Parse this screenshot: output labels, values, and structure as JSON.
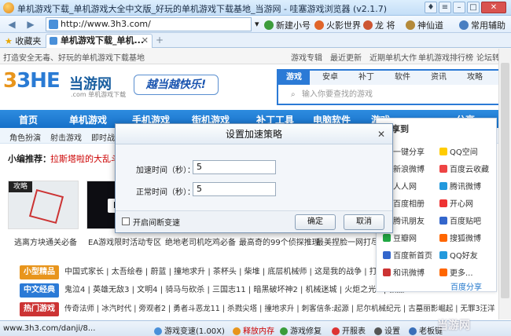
{
  "window": {
    "title": "单机游戏下载_单机游戏大全中文版_好玩的单机游戏下载基地_当游网 - 哇塞游戏浏览器 (v2.1.7)"
  },
  "toolbar": {
    "back": "◀",
    "forward": "▶",
    "url": "http://www.3h3.com/",
    "dropdown": "▾",
    "links": [
      "新建小号",
      "火影世界",
      "龙  将",
      "神仙道",
      "常用辅助"
    ]
  },
  "tabs": {
    "favorites": "收藏夹",
    "active_tab": "单机游戏下载_单机...",
    "close": "✕",
    "new_tab": "+"
  },
  "site": {
    "top_left": "打造安全无毒、好玩的单机游戏下载基地",
    "top_links": [
      "游戏专辑",
      "最近更新",
      "近期单机大作",
      "单机游戏排行榜",
      "论坛转"
    ],
    "logo": "3HE",
    "logo_cn": "当游网",
    "logo_sub": ".com 单机游戏下载",
    "slogan": "越当越快乐!",
    "search_tabs": [
      "游戏",
      "安卓",
      "补丁",
      "软件",
      "资讯",
      "攻略"
    ],
    "search_placeholder": "输入你要查找的游戏",
    "main_nav": [
      "首页",
      "单机游戏",
      "手机游戏",
      "街机游戏",
      "补丁工具",
      "电脑软件",
      "游戏",
      "分享"
    ],
    "sub_nav": [
      "角色扮演",
      "射击游戏",
      "即时战略"
    ],
    "recommend_label": "小编推荐：",
    "recommend_text": "拉斯塔啦的大乱斗新作",
    "thumb_badge": "攻略",
    "captions": [
      "逃离方块通关必备",
      "EA游戏限时活动专区",
      "绝地老司机吃鸡必备",
      "最高奇的99个侦探推理",
      "最美捏脸一网打尽"
    ],
    "sections": [
      {
        "label": "小型精品",
        "items": "中国式家长 | 太吾绘卷 | 蔚蓝 | 撞地求升 | 茶杯头 | 柴堆 | 底层机械师 | 这是我的战争 | 打造世"
      },
      {
        "label": "中文经典",
        "items": "鬼泣4 | 英雄无敌3 | 文明4 | 骑马与砍杀 | 三国志11 | 暗黑破坏神2 | 机械迷城 | 火炬之光2 | 极品"
      },
      {
        "label": "热门游戏",
        "items": "传奇法师 | 冰汽时代 | 旁观者2 | 勇者斗恶龙11 | 杀戮尖塔 | 撞地求升 | 刺客信条:起源 | 尼尔机械纪元 | 古墓丽影崛起 | 无罪3汪洋"
      }
    ]
  },
  "share_panel": {
    "title": "分享到",
    "items": [
      [
        "一键分享",
        "QQ空间"
      ],
      [
        "新浪微博",
        "百度云收藏"
      ],
      [
        "人人网",
        "腾讯微博"
      ],
      [
        "百度相册",
        "开心网"
      ],
      [
        "腾讯朋友",
        "百度贴吧"
      ],
      [
        "豆瓣网",
        "搜狐微博"
      ],
      [
        "百度新首页",
        "QQ好友"
      ],
      [
        "和讯微博",
        "更多..."
      ]
    ],
    "footer": "百度分享"
  },
  "dialog": {
    "title": "设置加速策略",
    "close": "✕",
    "accel_label": "加速时间（秒）：",
    "accel_value": "5",
    "normal_label": "正常时间（秒）：",
    "normal_value": "5",
    "checkbox_label": "开启间断变速",
    "ok": "确定",
    "cancel": "取消"
  },
  "status": {
    "url": "www.3h3.com/danji/8...",
    "speed": "游戏变速(1.00X)",
    "memory": "释放内存",
    "repair": "游戏修复",
    "screenshot": "开服表",
    "settings": "设置",
    "boss_key": "老板键",
    "bottom_brand": "当游网"
  },
  "colors": {
    "accent": "#2b7ad6",
    "nav": "#1670c8",
    "logo_blue": "#1a5fa0",
    "red": "#cc0000"
  }
}
